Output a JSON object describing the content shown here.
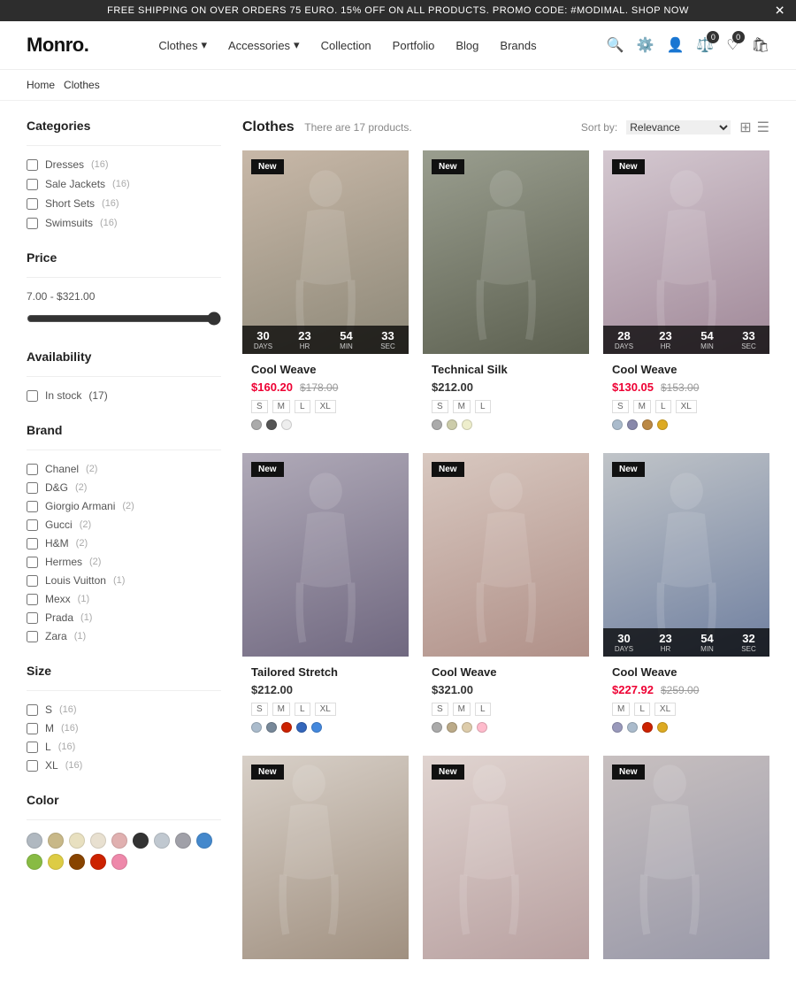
{
  "announcement": {
    "text": "FREE SHIPPING ON OVER ORDERS 75 EURO. 15% OFF ON ALL PRODUCTS. PROMO CODE: #MODIMAL. SHOP NOW"
  },
  "header": {
    "logo": "Monro.",
    "nav": [
      {
        "label": "Clothes",
        "hasDropdown": true
      },
      {
        "label": "Accessories",
        "hasDropdown": true
      },
      {
        "label": "Collection",
        "hasDropdown": false
      },
      {
        "label": "Portfolio",
        "hasDropdown": false
      },
      {
        "label": "Blog",
        "hasDropdown": false
      },
      {
        "label": "Brands",
        "hasDropdown": false
      }
    ]
  },
  "breadcrumb": {
    "home": "Home",
    "current": "Clothes"
  },
  "sidebar": {
    "categories_title": "Categories",
    "categories": [
      {
        "label": "Dresses",
        "count": "(16)"
      },
      {
        "label": "Sale Jackets",
        "count": "(16)"
      },
      {
        "label": "Short Sets",
        "count": "(16)"
      },
      {
        "label": "Swimsuits",
        "count": "(16)"
      }
    ],
    "price_title": "Price",
    "price_range": "7.00 - $321.00",
    "availability_title": "Availability",
    "in_stock": "In stock",
    "in_stock_count": "(17)",
    "brand_title": "Brand",
    "brands": [
      {
        "label": "Chanel",
        "count": "(2)"
      },
      {
        "label": "D&G",
        "count": "(2)"
      },
      {
        "label": "Giorgio Armani",
        "count": "(2)"
      },
      {
        "label": "Gucci",
        "count": "(2)"
      },
      {
        "label": "H&M",
        "count": "(2)"
      },
      {
        "label": "Hermes",
        "count": "(2)"
      },
      {
        "label": "Louis Vuitton",
        "count": "(1)"
      },
      {
        "label": "Mexx",
        "count": "(1)"
      },
      {
        "label": "Prada",
        "count": "(1)"
      },
      {
        "label": "Zara",
        "count": "(1)"
      }
    ],
    "size_title": "Size",
    "sizes": [
      {
        "label": "S",
        "count": "(16)"
      },
      {
        "label": "M",
        "count": "(16)"
      },
      {
        "label": "L",
        "count": "(16)"
      },
      {
        "label": "XL",
        "count": "(16)"
      }
    ],
    "color_title": "Color",
    "colors": [
      "#b0b8c0",
      "#c8b888",
      "#e8e0c0",
      "#e8e0d0",
      "#e0b0b0",
      "#333333",
      "#c0c8d0",
      "#a0a0a8",
      "#4488cc",
      "#88bb44",
      "#ddcc44",
      "#884400",
      "#cc2200",
      "#ee88aa"
    ]
  },
  "products": {
    "title": "Clothes",
    "subtitle": "There are 17 products.",
    "sort_label": "Sort by:",
    "sort_value": "Relevance",
    "items": [
      {
        "name": "Cool Weave",
        "badge": "New",
        "price_sale": "$160.20",
        "price_original": "$178.00",
        "sizes": [
          "S",
          "M",
          "L",
          "XL"
        ],
        "colors": [
          "#aaaaaa",
          "#555555",
          "#eeeeee"
        ],
        "has_countdown": true,
        "countdown": {
          "days": "30",
          "hrs": "23",
          "min": "54",
          "sec": "33"
        },
        "bg": "img-bg-1"
      },
      {
        "name": "Technical Silk",
        "badge": "New",
        "price_regular": "$212.00",
        "sizes": [
          "S",
          "M",
          "L"
        ],
        "colors": [
          "#aaaaaa",
          "#ccccaa",
          "#eeeecc"
        ],
        "has_countdown": false,
        "bg": "img-bg-2"
      },
      {
        "name": "Cool Weave",
        "badge": "New",
        "price_sale": "$130.05",
        "price_original": "$153.00",
        "sizes": [
          "S",
          "M",
          "L",
          "XL"
        ],
        "colors": [
          "#aabbcc",
          "#8888aa",
          "#bb8844",
          "#ddaa22"
        ],
        "has_countdown": true,
        "countdown": {
          "days": "28",
          "hrs": "23",
          "min": "54",
          "sec": "33"
        },
        "bg": "img-bg-3"
      },
      {
        "name": "Tailored Stretch",
        "badge": "New",
        "price_regular": "$212.00",
        "sizes": [
          "S",
          "M",
          "L",
          "XL"
        ],
        "colors": [
          "#aabbcc",
          "#778899",
          "#cc2200",
          "#3366bb",
          "#4488dd"
        ],
        "has_countdown": false,
        "bg": "img-bg-4"
      },
      {
        "name": "Cool Weave",
        "badge": "New",
        "price_regular": "$321.00",
        "sizes": [
          "S",
          "M",
          "L"
        ],
        "colors": [
          "#aaaaaa",
          "#bbaa88",
          "#ddccaa",
          "#ffbbcc"
        ],
        "has_countdown": false,
        "bg": "img-bg-5"
      },
      {
        "name": "Cool Weave",
        "badge": "New",
        "price_sale": "$227.92",
        "price_original": "$259.00",
        "sizes": [
          "M",
          "L",
          "XL"
        ],
        "colors": [
          "#9999bb",
          "#aabbcc",
          "#cc2200",
          "#ddaa22"
        ],
        "has_countdown": true,
        "countdown": {
          "days": "30",
          "hrs": "23",
          "min": "54",
          "sec": "32"
        },
        "bg": "img-bg-6"
      },
      {
        "name": "",
        "badge": "New",
        "price_regular": "",
        "sizes": [],
        "colors": [],
        "has_countdown": false,
        "bg": "img-bg-7"
      },
      {
        "name": "",
        "badge": "New",
        "price_regular": "",
        "sizes": [],
        "colors": [],
        "has_countdown": false,
        "bg": "img-bg-8"
      },
      {
        "name": "",
        "badge": "New",
        "price_regular": "",
        "sizes": [],
        "colors": [],
        "has_countdown": false,
        "bg": "img-bg-9"
      }
    ]
  }
}
